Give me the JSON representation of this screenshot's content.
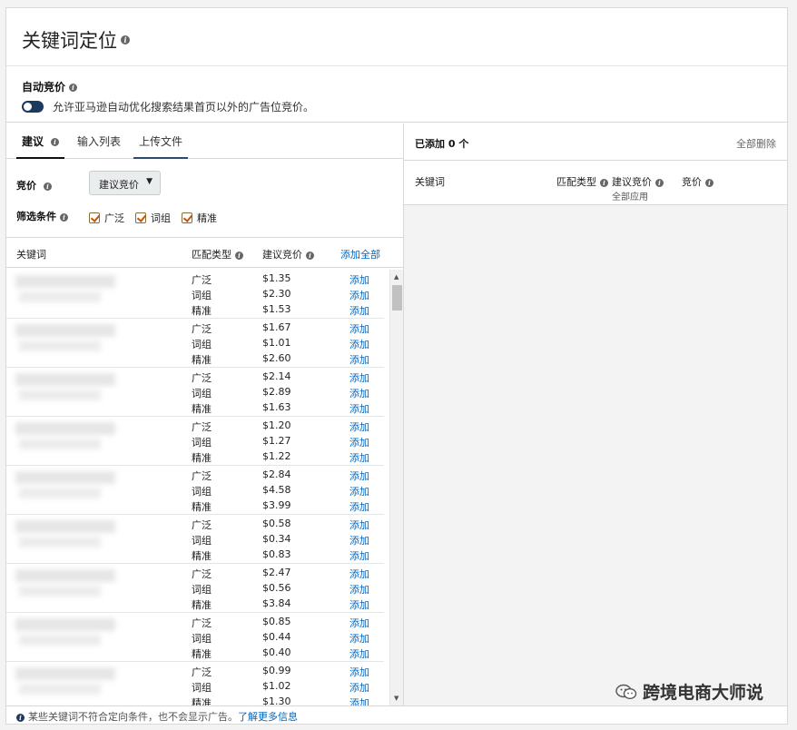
{
  "header": {
    "title": "关键词定位"
  },
  "auto_bid": {
    "label": "自动竞价",
    "description": "允许亚马逊自动优化搜索结果首页以外的广告位竞价。",
    "enabled": true
  },
  "tabs": [
    {
      "label": "建议"
    },
    {
      "label": "输入列表"
    },
    {
      "label": "上传文件"
    }
  ],
  "filters": {
    "bid_label": "竞价",
    "bid_select": "建议竞价",
    "filter_label": "筛选条件",
    "checkboxes": [
      {
        "label": "广泛",
        "checked": true
      },
      {
        "label": "词组",
        "checked": true
      },
      {
        "label": "精准",
        "checked": true
      }
    ]
  },
  "table": {
    "col_keyword": "关键词",
    "col_match": "匹配类型",
    "col_bid": "建议竞价",
    "add_all": "添加全部",
    "match_labels": [
      "广泛",
      "词组",
      "精准"
    ],
    "add_label": "添加",
    "groups": [
      {
        "bids": [
          "$1.35",
          "$2.30",
          "$1.53"
        ]
      },
      {
        "bids": [
          "$1.67",
          "$1.01",
          "$2.60"
        ]
      },
      {
        "bids": [
          "$2.14",
          "$2.89",
          "$1.63"
        ]
      },
      {
        "bids": [
          "$1.20",
          "$1.27",
          "$1.22"
        ]
      },
      {
        "bids": [
          "$2.84",
          "$4.58",
          "$3.99"
        ]
      },
      {
        "bids": [
          "$0.58",
          "$0.34",
          "$0.83"
        ]
      },
      {
        "bids": [
          "$2.47",
          "$0.56",
          "$3.84"
        ]
      },
      {
        "bids": [
          "$0.85",
          "$0.44",
          "$0.40"
        ]
      },
      {
        "bids": [
          "$0.99",
          "$1.02",
          "$1.30"
        ]
      }
    ]
  },
  "added_panel": {
    "added_count": "已添加 0 个",
    "remove_all": "全部删除",
    "col_keyword": "关键词",
    "col_match": "匹配类型",
    "col_suggested": "建议竞价",
    "apply_all": "全部应用",
    "col_bid": "竞价"
  },
  "footer": {
    "note": "某些关键词不符合定向条件，也不会显示广告。",
    "link": "了解更多信息"
  },
  "watermark": {
    "text": "跨境电商大师说"
  }
}
